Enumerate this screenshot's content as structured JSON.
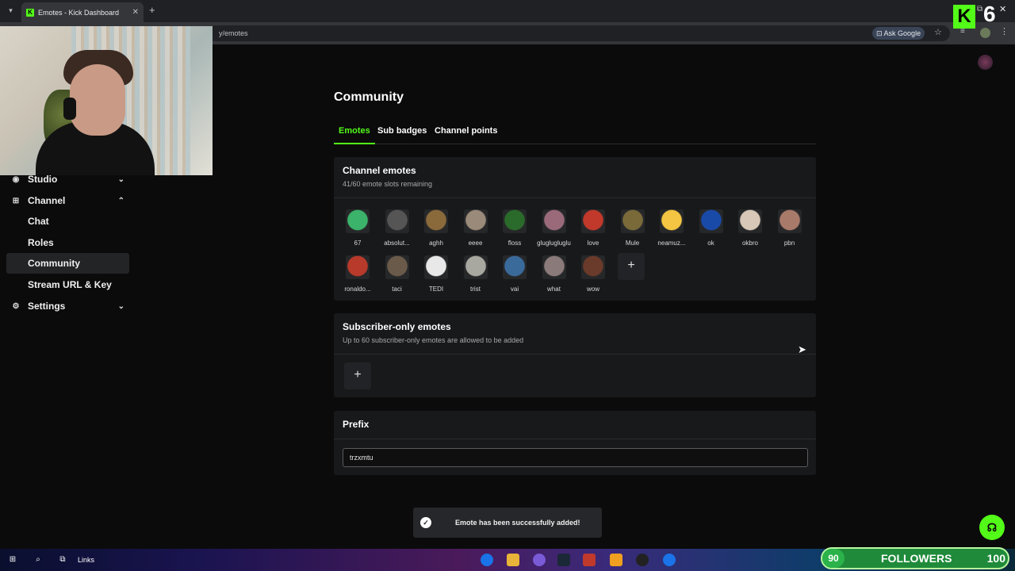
{
  "browser": {
    "tab_title": "Emotes - Kick Dashboard",
    "tab_close": "✕",
    "tab_list_icon": "chevron-down-icon",
    "new_tab": "+",
    "url": "y/emotes",
    "ask_google": "Ask Google",
    "star": "☆",
    "menu": "⋮",
    "minimize": "⧉",
    "close": "✕"
  },
  "overlay": {
    "kick_letter": "K",
    "number": "6"
  },
  "sidebar": {
    "items": [
      {
        "label": "Studio",
        "icon": "studio-icon",
        "glyph": "◉",
        "chevron": "⌄"
      },
      {
        "label": "Channel",
        "icon": "channel-icon",
        "glyph": "⊞",
        "chevron": "⌃"
      },
      {
        "label": "Settings",
        "icon": "gear-icon",
        "glyph": "⚙",
        "chevron": "⌄"
      }
    ],
    "subitems": [
      "Chat",
      "Roles",
      "Community",
      "Stream URL & Key"
    ]
  },
  "main": {
    "title": "Community",
    "tabs": [
      "Emotes",
      "Sub badges",
      "Channel points"
    ],
    "channel_emotes": {
      "title": "Channel emotes",
      "subtitle": "41/60 emote slots remaining",
      "emotes": [
        "67",
        "absolut...",
        "aghh",
        "eeee",
        "floss",
        "gluglugluglu",
        "love",
        "Mule",
        "neamuz...",
        "ok",
        "okbro",
        "pbn",
        "ronaldo...",
        "taci",
        "TEDI",
        "trist",
        "vai",
        "what",
        "wow"
      ],
      "add": "+"
    },
    "subscriber_emotes": {
      "title": "Subscriber-only emotes",
      "subtitle": "Up to 60 subscriber-only emotes are allowed to be added",
      "add": "+"
    },
    "prefix": {
      "title": "Prefix",
      "value": "trzxmtu"
    }
  },
  "toast": {
    "message": "Emote has been successfully added!",
    "icon": "✓"
  },
  "taskbar": {
    "links": "Links"
  },
  "followers": {
    "current": "90",
    "label": "FOLLOWERS",
    "goal": "100"
  },
  "colors": {
    "accent": "#53fc18",
    "background": "#0b0b0c",
    "card": "#18191b"
  }
}
